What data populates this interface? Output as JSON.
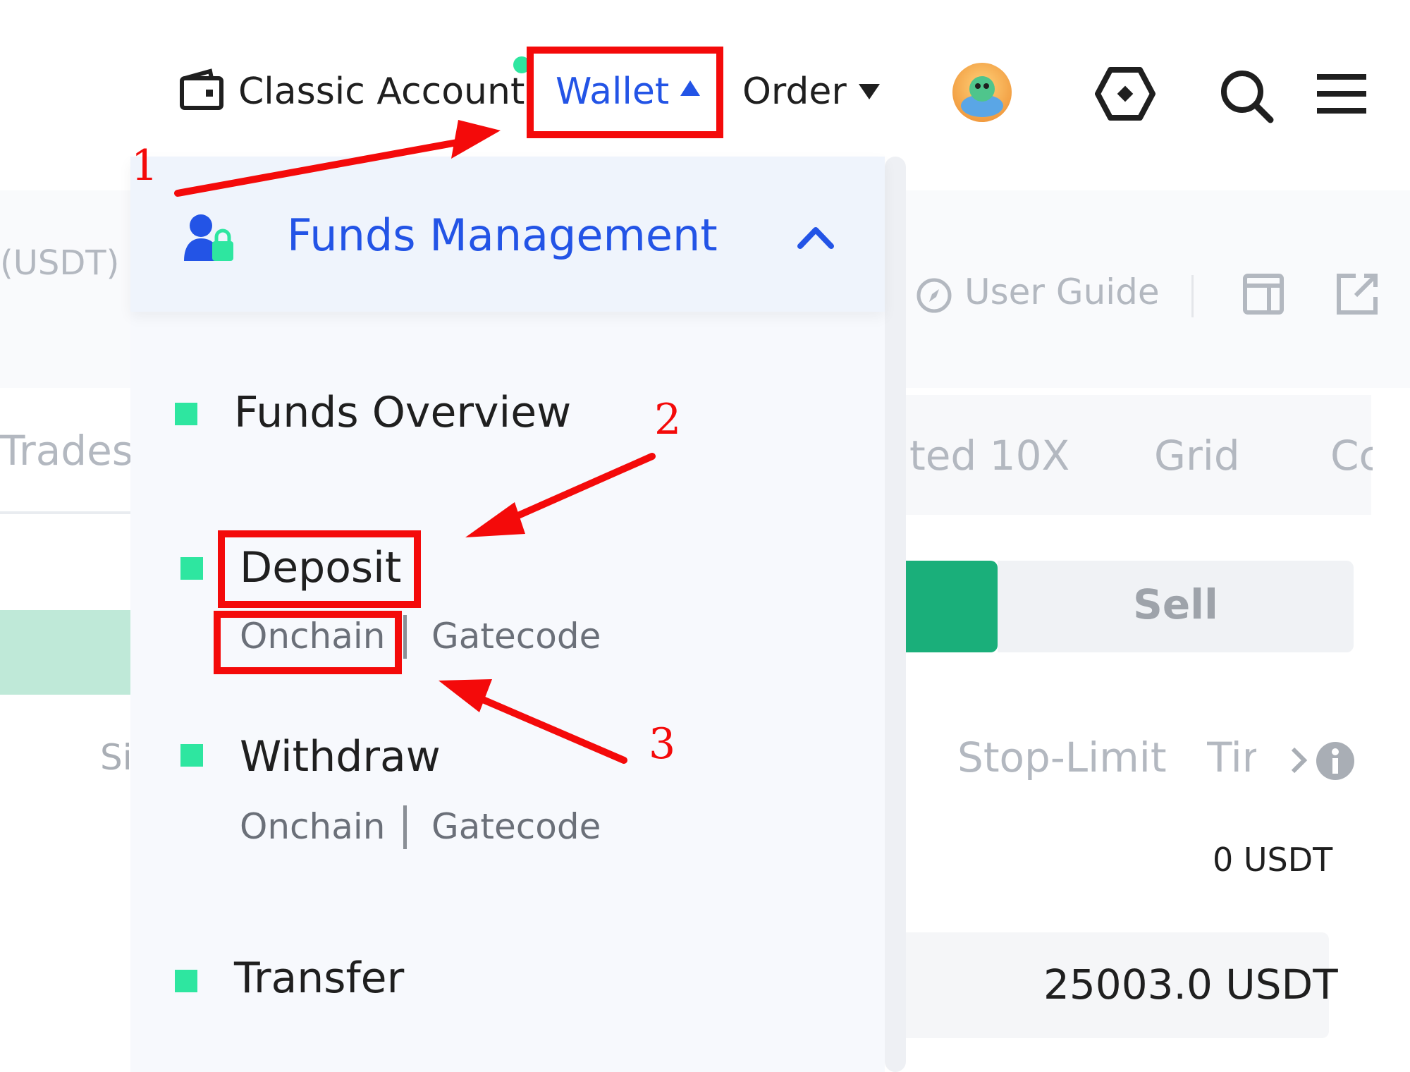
{
  "nav": {
    "classic_account": "Classic Account",
    "wallet": "Wallet",
    "order": "Order"
  },
  "background": {
    "usdt_label": "(USDT)",
    "user_guide": "User Guide",
    "trades_tab": "Trades",
    "tab_leveraged": "ted 10X",
    "tab_grid": "Grid",
    "tab_partial": "Cc",
    "sell_button": "Sell",
    "side_partial": "Si",
    "stop_limit": "Stop-Limit",
    "time_partial": "Tir",
    "available_balance": "0 USDT",
    "max_amount": "25003.0 USDT"
  },
  "dropdown": {
    "section_title": "Funds Management",
    "items": [
      {
        "label": "Funds Overview"
      },
      {
        "label": "Deposit",
        "sub": [
          "Onchain",
          "Gatecode"
        ]
      },
      {
        "label": "Withdraw",
        "sub": [
          "Onchain",
          "Gatecode"
        ]
      },
      {
        "label": "Transfer"
      }
    ]
  },
  "annotations": [
    "1",
    "2",
    "3"
  ],
  "colors": {
    "accent_blue": "#2354e6",
    "bullet_green": "#2ee6a0",
    "buy_green": "#1aaf7a",
    "annotation_red": "#f40a0a"
  },
  "icons": {
    "classic_account": "wallet-icon",
    "order_caret": "caret-down-icon",
    "wallet_caret": "caret-up-icon",
    "avatar": "avatar",
    "settings": "hexagon-icon",
    "search": "search-icon",
    "menu": "hamburger-icon",
    "funds_management": "user-lock-icon",
    "collapse": "chevron-up-icon",
    "user_guide": "compass-icon",
    "layout": "layout-icon",
    "export": "export-icon",
    "info": "info-icon"
  }
}
